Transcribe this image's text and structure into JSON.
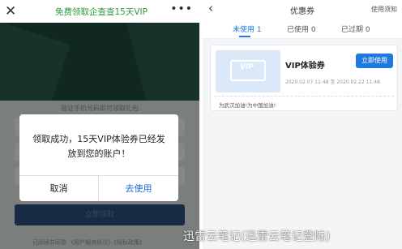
{
  "left_screen": {
    "topbar": {
      "close_icon": "close-icon",
      "title": "免费领取企查查15天VIP",
      "more_icon": "more-icon",
      "title_color": "#2a9a3c"
    },
    "form": {
      "phone_label": "验证手机号码即可领取礼包",
      "claim_button": "立即领取",
      "agreement": "已阅读并同意 《用户服务协议》《隐私政策》"
    },
    "dialog": {
      "message": "领取成功，15天VIP体验券已经发放到您的账户！",
      "cancel": "取消",
      "use": "去使用",
      "use_color": "#1a6fd1"
    }
  },
  "right_screen": {
    "topbar": {
      "back_icon": "back-chevron-icon",
      "title": "优惠券",
      "help": "使用须知"
    },
    "tabs": [
      {
        "label": "未使用 1",
        "active": true
      },
      {
        "label": "已使用 0",
        "active": false
      },
      {
        "label": "已过期 0",
        "active": false
      }
    ],
    "accent_color": "#1f7ae0",
    "coupon": {
      "icon": "vip-ticket-icon",
      "badge": "VIP",
      "name": "VIP体验券",
      "button": "立即使用",
      "validity": "2020.02.07 11:48 至 2020.02.22 11:48",
      "slogan": "为武汉加油!为中国加油!"
    }
  },
  "watermark": "迅雷云笔记(迅雷云笔记登陆)"
}
